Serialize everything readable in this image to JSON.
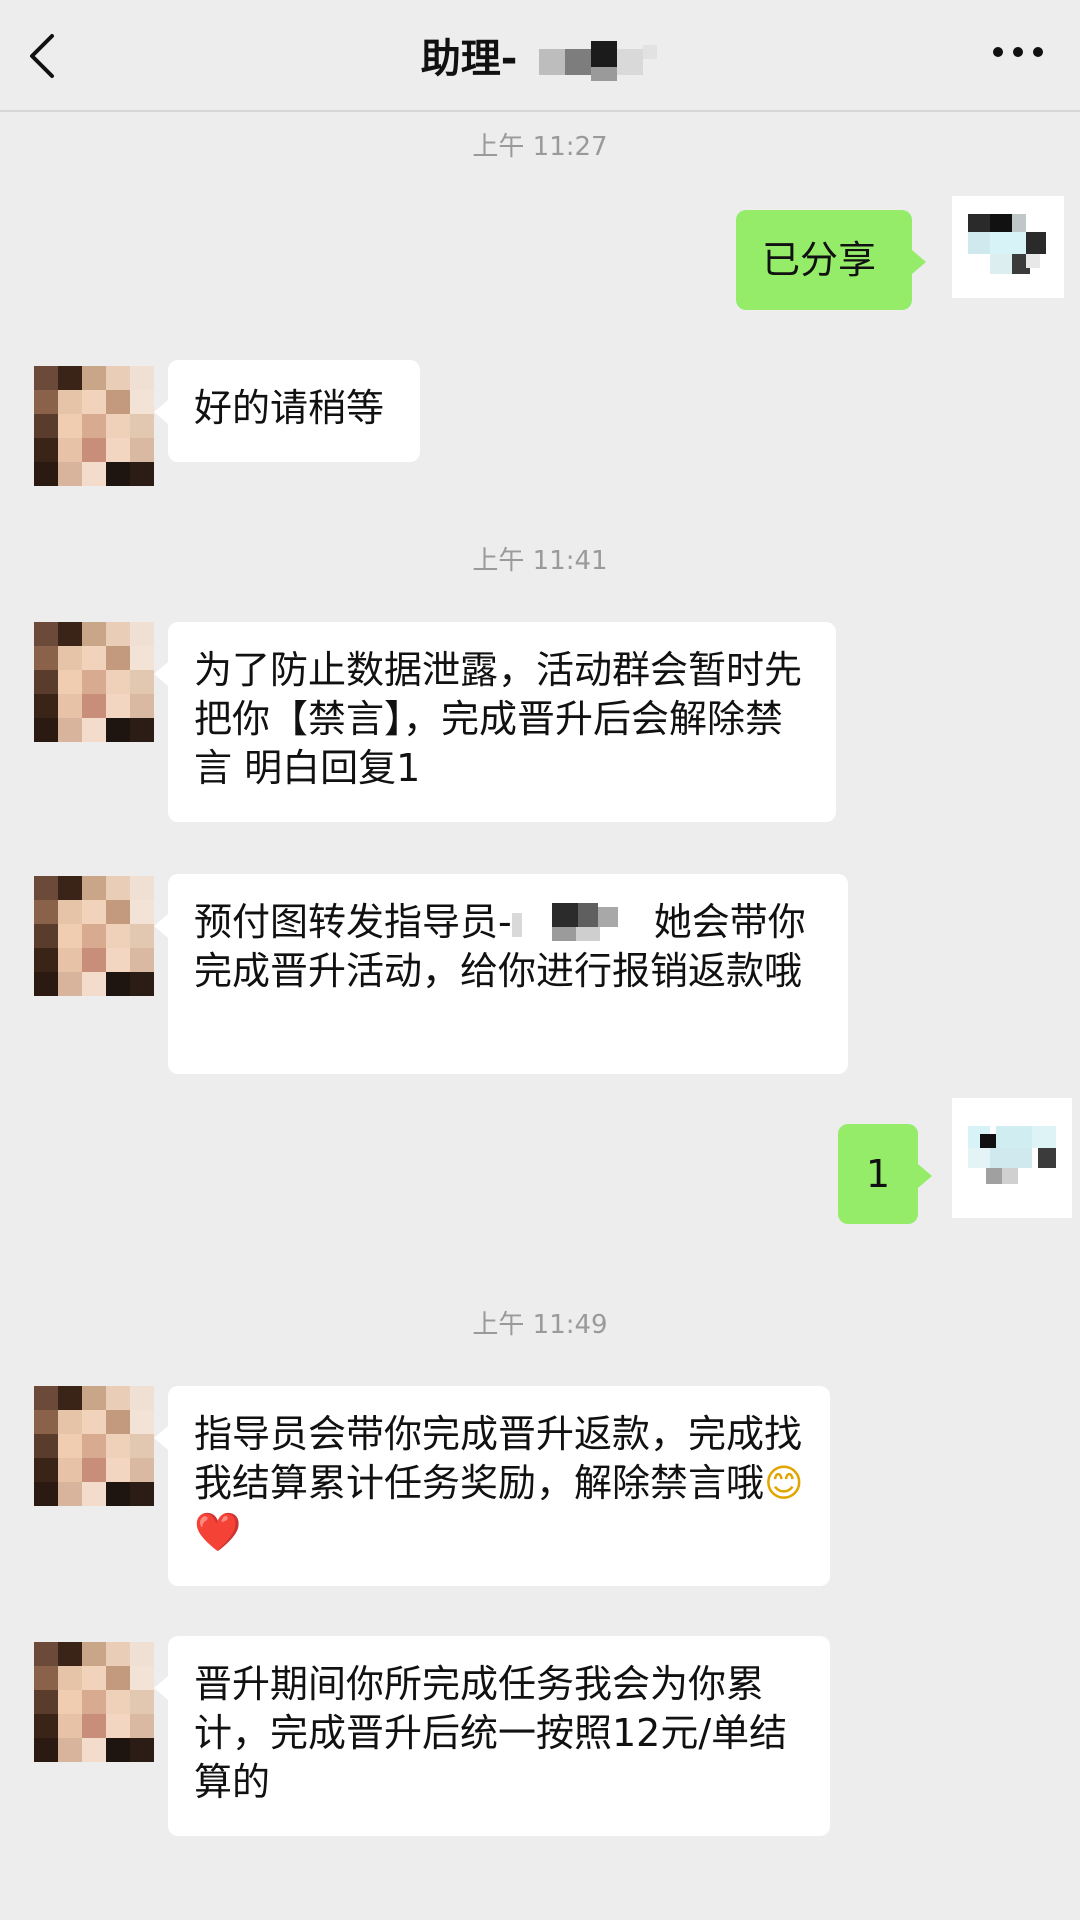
{
  "header": {
    "title": "助理-",
    "back_icon": "chevron-left-icon",
    "more_icon": "more-dots-icon"
  },
  "messages": [
    {
      "type": "time",
      "text": "上午 11:27"
    },
    {
      "type": "out",
      "text": "已分享"
    },
    {
      "type": "in",
      "text": "好的请稍等"
    },
    {
      "type": "time",
      "text": "上午 11:41"
    },
    {
      "type": "in",
      "text": "为了防止数据泄露，活动群会暂时先把你【禁言】，完成晋升后会解除禁言 明白回复1"
    },
    {
      "type": "in",
      "text_before": "预付图转发指导员-",
      "text_after": " 她会带你完成晋升活动，给你进行报销返款哦"
    },
    {
      "type": "out",
      "text": "1"
    },
    {
      "type": "time",
      "text": "上午 11:49"
    },
    {
      "type": "in",
      "text": "指导员会带你完成晋升返款，完成找我结算累计任务奖励，解除禁言哦",
      "emoji": "😊",
      "heart": "❤️"
    },
    {
      "type": "in",
      "text": "晋升期间你所完成任务我会为你累计，完成晋升后统一按照12元/单结算的"
    }
  ]
}
